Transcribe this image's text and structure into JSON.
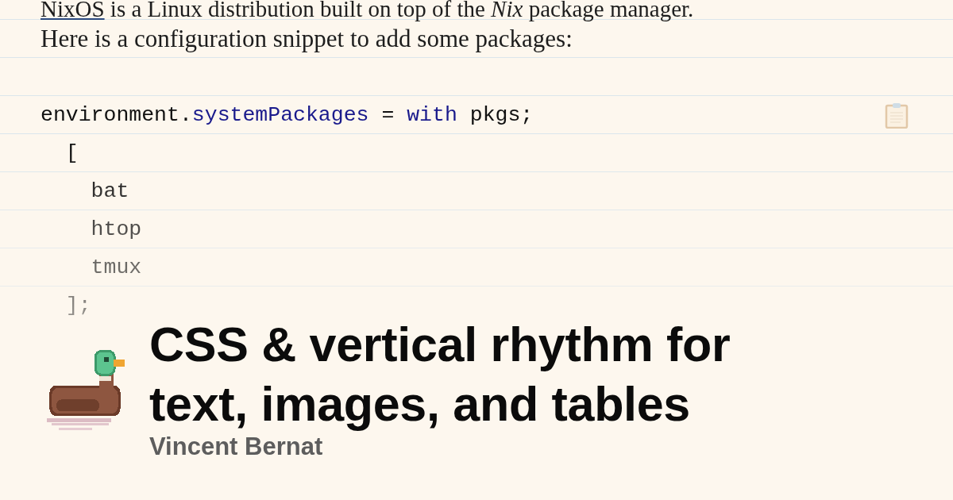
{
  "article": {
    "sentences": [
      {
        "link": "NixOS",
        "text": " is a Linux distribution built on top of the *Nix* package manager."
      },
      {
        "text": "Here is a configuration snippet to add some packages:"
      }
    ]
  },
  "code": {
    "lines": [
      [
        {
          "text": "environment.",
          "kind": "plain"
        },
        {
          "text": "systemPackages",
          "kind": "attr"
        },
        {
          "text": " = ",
          "kind": "plain"
        },
        {
          "text": "with",
          "kind": "keyword"
        },
        {
          "text": " pkgs;",
          "kind": "plain"
        }
      ],
      [
        {
          "text": "  [",
          "kind": "plain"
        }
      ],
      [
        {
          "text": "    bat",
          "kind": "plain"
        }
      ],
      [
        {
          "text": "    htop",
          "kind": "plain"
        }
      ],
      [
        {
          "text": "    tmux",
          "kind": "plain"
        }
      ],
      [
        {
          "text": "  ];",
          "kind": "plain"
        }
      ]
    ]
  },
  "post": {
    "title": "CSS & vertical rhythm for text, images, and tables",
    "author": "Vincent Bernat"
  }
}
